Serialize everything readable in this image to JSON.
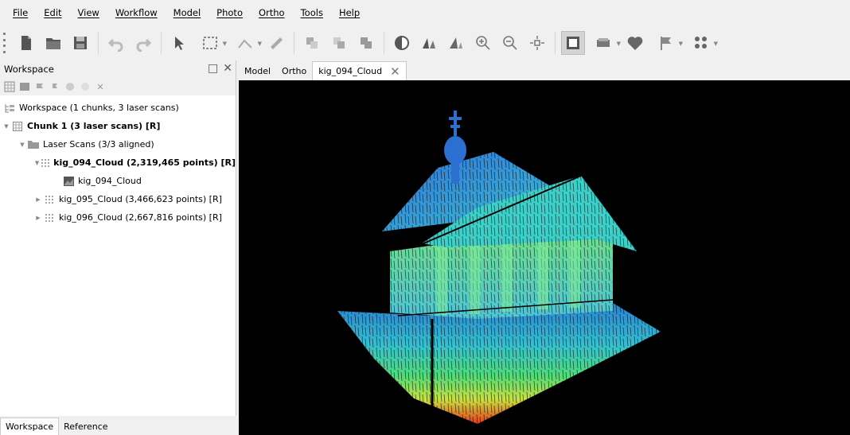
{
  "menu": [
    "File",
    "Edit",
    "View",
    "Workflow",
    "Model",
    "Photo",
    "Ortho",
    "Tools",
    "Help"
  ],
  "toolbar": {
    "icons": [
      "new-document-icon",
      "open-folder-icon",
      "save-icon",
      "undo-icon",
      "redo-icon",
      "select-arrow-icon",
      "rectangle-selection-icon",
      "ruler-tool-icon",
      "measure-icon",
      "copy-icon",
      "paste-icon",
      "duplicate-icon",
      "contrast-icon",
      "reset-view-icon",
      "rotate-view-icon",
      "zoom-in-icon",
      "zoom-out-icon",
      "move-icon",
      "show-cameras-icon",
      "show-region-icon",
      "show-markers-icon",
      "show-flags-icon",
      "show-points-icon"
    ]
  },
  "workspace": {
    "title": "Workspace",
    "tree": [
      {
        "label": "Workspace (1 chunks, 3 laser scans)",
        "level": 0,
        "icon": "workspace-icon",
        "bold": false
      },
      {
        "label": "Chunk 1 (3 laser scans) [R]",
        "level": 1,
        "icon": "chunk-icon",
        "bold": true,
        "expanded": true
      },
      {
        "label": "Laser Scans (3/3 aligned)",
        "level": 2,
        "icon": "folder-icon",
        "bold": false,
        "expanded": true
      },
      {
        "label": "kig_094_Cloud (2,319,465 points) [R]",
        "level": 3,
        "icon": "point-cloud-icon",
        "bold": true,
        "expanded": true
      },
      {
        "label": "kig_094_Cloud",
        "level": 4,
        "icon": "scan-image-icon",
        "bold": false
      },
      {
        "label": "kig_095_Cloud (3,466,623 points) [R]",
        "level": 3,
        "icon": "point-cloud-icon",
        "bold": false,
        "expanded": false
      },
      {
        "label": "kig_096_Cloud (2,667,816 points) [R]",
        "level": 3,
        "icon": "point-cloud-icon",
        "bold": false,
        "expanded": false
      }
    ],
    "bottom_tabs": [
      "Workspace",
      "Reference"
    ]
  },
  "doc_tabs": [
    "Model",
    "Ortho",
    "kig_094_Cloud"
  ],
  "active_doc_tab": "kig_094_Cloud",
  "colors": {
    "viewport_bg": "#000000",
    "panel_bg": "#f0f0f0"
  }
}
